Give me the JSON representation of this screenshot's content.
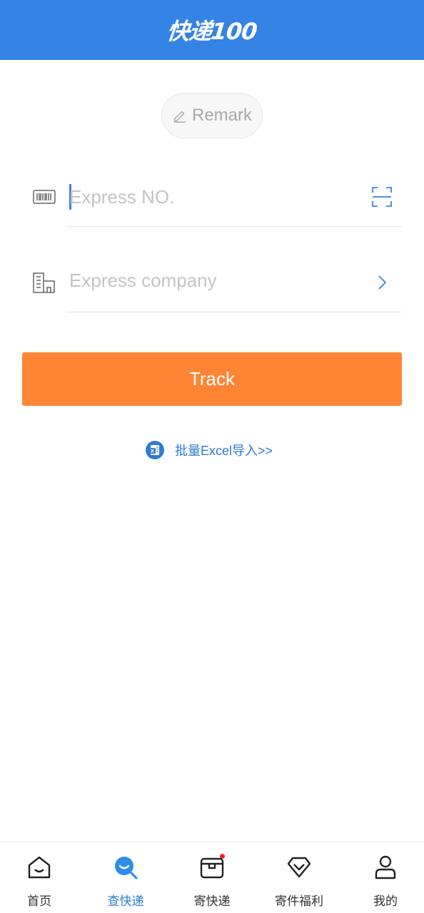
{
  "header": {
    "logo_text": "快递100",
    "bg_color": "#3583e5"
  },
  "remark": {
    "label": "Remark",
    "icon": "pencil-icon"
  },
  "express_no": {
    "placeholder": "Express NO.",
    "lead_icon": "barcode-icon",
    "trail_icon": "scan-icon"
  },
  "express_company": {
    "placeholder": "Express company",
    "lead_icon": "building-icon",
    "trail_icon": "chevron-right-icon"
  },
  "track_button": {
    "label": "Track",
    "color": "#ff8534"
  },
  "excel_import": {
    "label": "批量Excel导入>>",
    "icon": "excel-icon"
  },
  "tabbar": {
    "active_color": "#2f7bd4",
    "items": [
      {
        "label": "首页",
        "icon": "home-icon"
      },
      {
        "label": "查快递",
        "icon": "search-icon",
        "active": true
      },
      {
        "label": "寄快递",
        "icon": "package-icon",
        "badge_dot": true
      },
      {
        "label": "寄件福利",
        "icon": "diamond-icon"
      },
      {
        "label": "我的",
        "icon": "user-icon"
      }
    ]
  }
}
